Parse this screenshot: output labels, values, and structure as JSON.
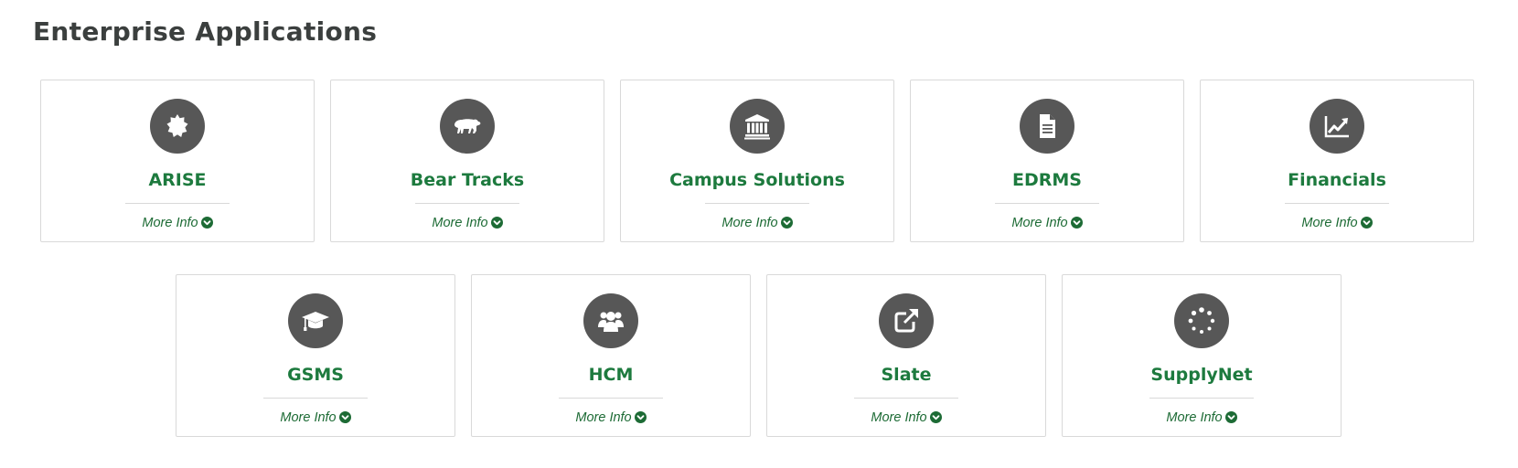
{
  "page": {
    "title": "Enterprise Applications"
  },
  "colors": {
    "accent": "#1d7a3e",
    "icon_bg": "#575757",
    "border": "#d9d9d9"
  },
  "cards": [
    {
      "name": "ARISE",
      "icon": "badge-icon",
      "more_info": "More Info"
    },
    {
      "name": "Bear Tracks",
      "icon": "bear-icon",
      "more_info": "More Info"
    },
    {
      "name": "Campus Solutions",
      "icon": "institution-icon",
      "more_info": "More Info"
    },
    {
      "name": "EDRMS",
      "icon": "document-icon",
      "more_info": "More Info"
    },
    {
      "name": "Financials",
      "icon": "line-chart-icon",
      "more_info": "More Info"
    },
    {
      "name": "GSMS",
      "icon": "graduation-cap-icon",
      "more_info": "More Info"
    },
    {
      "name": "HCM",
      "icon": "users-icon",
      "more_info": "More Info"
    },
    {
      "name": "Slate",
      "icon": "external-link-icon",
      "more_info": "More Info"
    },
    {
      "name": "SupplyNet",
      "icon": "spinner-icon",
      "more_info": "More Info"
    }
  ]
}
